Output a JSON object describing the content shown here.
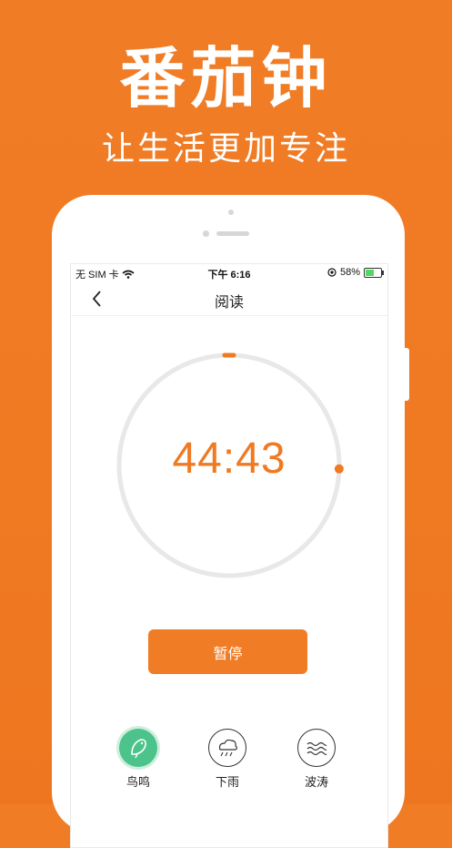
{
  "hero": {
    "title": "番茄钟",
    "subtitle": "让生活更加专注"
  },
  "status_bar": {
    "carrier": "无 SIM 卡",
    "time": "下午 6:16",
    "battery": "58%",
    "battery_level": 0.58
  },
  "nav": {
    "title": "阅读",
    "back_icon": "chevron-left-icon"
  },
  "timer": {
    "display": "44:43",
    "progress": 0.255
  },
  "actions": {
    "pause_label": "暂停"
  },
  "sounds": [
    {
      "label": "鸟鸣",
      "icon": "bird-icon",
      "active": true
    },
    {
      "label": "下雨",
      "icon": "rain-cloud-icon",
      "active": false
    },
    {
      "label": "波涛",
      "icon": "waves-icon",
      "active": false
    }
  ],
  "colors": {
    "accent": "#ef7a22",
    "active_sound": "#4cc38a",
    "ring_track": "#e8e8e8"
  }
}
